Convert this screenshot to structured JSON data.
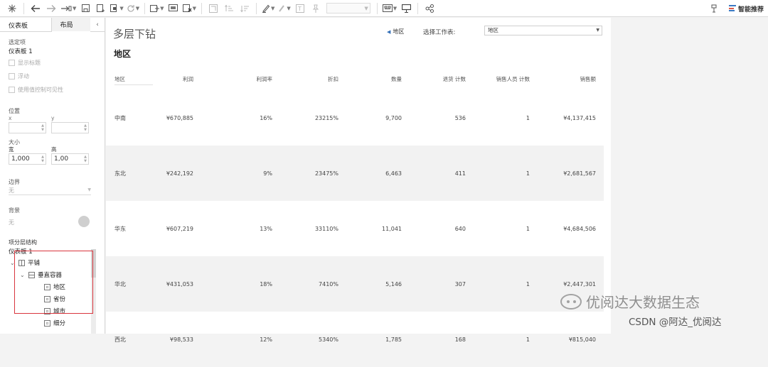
{
  "toolbar": {
    "smart_label": "智能推荐"
  },
  "left_panel": {
    "tabs": [
      "仪表板",
      "布局"
    ],
    "selected_item": {
      "label": "选定项",
      "value": "仪表板 1"
    },
    "checkboxes": [
      "显示标题",
      "浮动",
      "使用值控制可见性"
    ],
    "position": {
      "label": "位置",
      "x_label": "x",
      "y_label": "y"
    },
    "size": {
      "label": "大小",
      "width_label": "宽",
      "height_label": "高",
      "width_value": "1,000",
      "height_value": "1,00"
    },
    "border": {
      "label": "边界",
      "value": "无"
    },
    "background": {
      "label": "背景",
      "value": "无"
    },
    "hierarchy": {
      "label": "项分层结构",
      "root": "仪表板 1",
      "tiled": "平铺",
      "container": "垂直容器",
      "items": [
        "地区",
        "省份",
        "城市",
        "细分"
      ]
    }
  },
  "canvas": {
    "dashboard_title": "多层下钻",
    "sheet_title": "地区",
    "back_button": "地区",
    "worksheet_label": "选择工作表:",
    "worksheet_value": "地区",
    "table": {
      "headers": [
        "地区",
        "利润",
        "利润率",
        "折扣",
        "数量",
        "退货 计数",
        "销售人员 计数",
        "销售额"
      ],
      "rows": [
        [
          "中南",
          "¥670,885",
          "16%",
          "23215%",
          "9,700",
          "536",
          "1",
          "¥4,137,415"
        ],
        [
          "东北",
          "¥242,192",
          "9%",
          "23475%",
          "6,463",
          "411",
          "1",
          "¥2,681,567"
        ],
        [
          "华东",
          "¥607,219",
          "13%",
          "33110%",
          "11,041",
          "640",
          "1",
          "¥4,684,506"
        ],
        [
          "华北",
          "¥431,053",
          "18%",
          "7410%",
          "5,146",
          "307",
          "1",
          "¥2,447,301"
        ],
        [
          "西北",
          "¥98,533",
          "12%",
          "5340%",
          "1,785",
          "168",
          "1",
          "¥815,040"
        ]
      ]
    }
  },
  "watermark": {
    "text": "优阅达大数据生态",
    "csdn": "CSDN @阿达_优阅达"
  }
}
